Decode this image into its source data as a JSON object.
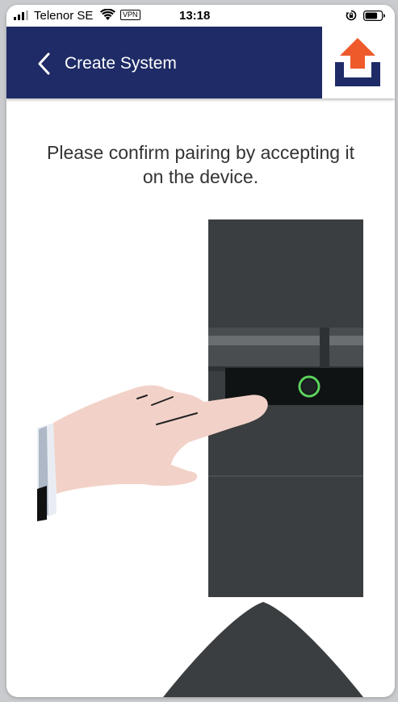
{
  "status_bar": {
    "carrier": "Telenor SE",
    "vpn": "VPN",
    "time": "13:18"
  },
  "header": {
    "title": "Create System",
    "back_icon": "chevron-left-icon",
    "logo_icon": "upload-arrow-logo"
  },
  "main": {
    "instruction": "Please confirm pairing by accepting it on the device."
  },
  "colors": {
    "header_bg": "#1e2b66",
    "logo_orange": "#ee5a2a",
    "logo_blue": "#1e2b66",
    "device_body": "#3b3e40",
    "led_green": "#5cd35c"
  }
}
